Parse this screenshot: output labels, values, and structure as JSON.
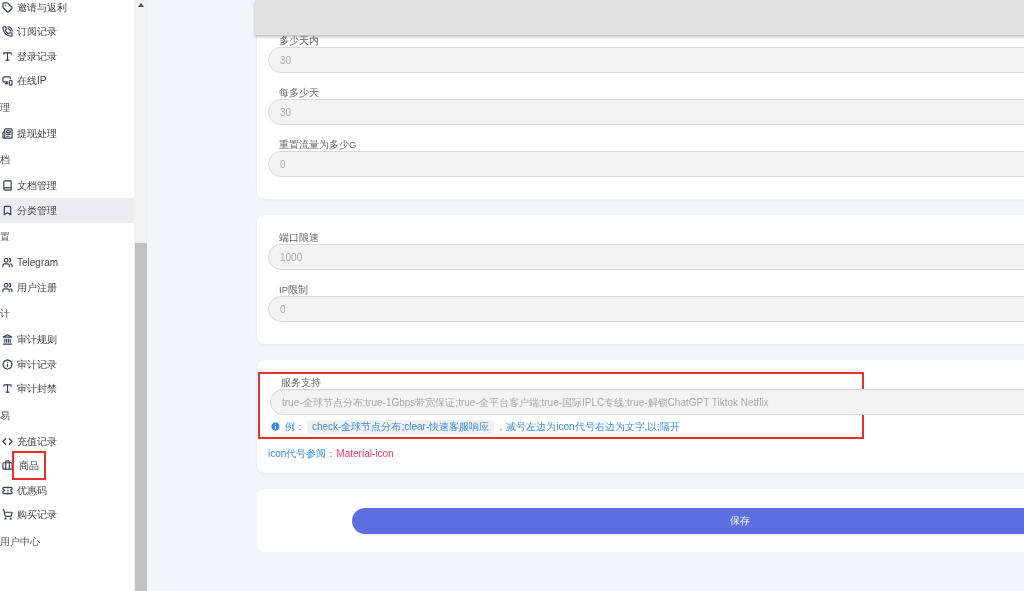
{
  "sidebar": {
    "entries": [
      {
        "kind": "item",
        "label": "邀请与返利",
        "selected": false
      },
      {
        "kind": "item",
        "label": "订阅记录",
        "selected": false
      },
      {
        "kind": "item",
        "label": "登录记录",
        "selected": false
      },
      {
        "kind": "item",
        "label": "在线IP",
        "selected": false
      },
      {
        "kind": "header",
        "label": "理"
      },
      {
        "kind": "item",
        "label": "提现处理",
        "selected": false
      },
      {
        "kind": "header",
        "label": "档"
      },
      {
        "kind": "item",
        "label": "文档管理",
        "selected": false
      },
      {
        "kind": "item",
        "label": "分类管理",
        "selected": true
      },
      {
        "kind": "header",
        "label": "置"
      },
      {
        "kind": "item",
        "label": "Telegram",
        "selected": false
      },
      {
        "kind": "item",
        "label": "用户注册",
        "selected": false
      },
      {
        "kind": "header",
        "label": "计"
      },
      {
        "kind": "item",
        "label": "审计规则",
        "selected": false
      },
      {
        "kind": "item",
        "label": "审计记录",
        "selected": false
      },
      {
        "kind": "item",
        "label": "审计封禁",
        "selected": false
      },
      {
        "kind": "header",
        "label": "易"
      },
      {
        "kind": "item",
        "label": "充值记录",
        "selected": false
      },
      {
        "kind": "item",
        "label": "商品",
        "selected": false,
        "highlighted": true
      },
      {
        "kind": "item",
        "label": "优惠码",
        "selected": false
      },
      {
        "kind": "item",
        "label": "购买记录",
        "selected": false
      },
      {
        "kind": "header",
        "label": "用户中心"
      }
    ]
  },
  "cards": [
    {
      "fields": [
        {
          "label": "多少天内",
          "value": "30"
        },
        {
          "label": "每多少天",
          "value": "30"
        },
        {
          "label": "重置流量为多少G",
          "value": "0"
        }
      ]
    },
    {
      "fields": [
        {
          "label": "端口限速",
          "value": "1000"
        },
        {
          "label": "IP限制",
          "value": "0"
        }
      ]
    },
    {
      "fields": [
        {
          "label": "服务支持",
          "value": "true-全球节点分布;true-1Gbps带宽保证;true-全平台客户端;true-国际IPLC专线;true-解锁ChatGPT Tiktok Netflix",
          "highlighted": true,
          "hint": {
            "prefix": "例：",
            "code": "check-全球节点分布;clear-快速客服响应",
            "text": "，减号左边为icon代号右边为文字,以;隔开"
          }
        }
      ],
      "reference": {
        "label": "icon代号参阅：",
        "link": "Material-icon"
      }
    }
  ],
  "save_button": "保存"
}
